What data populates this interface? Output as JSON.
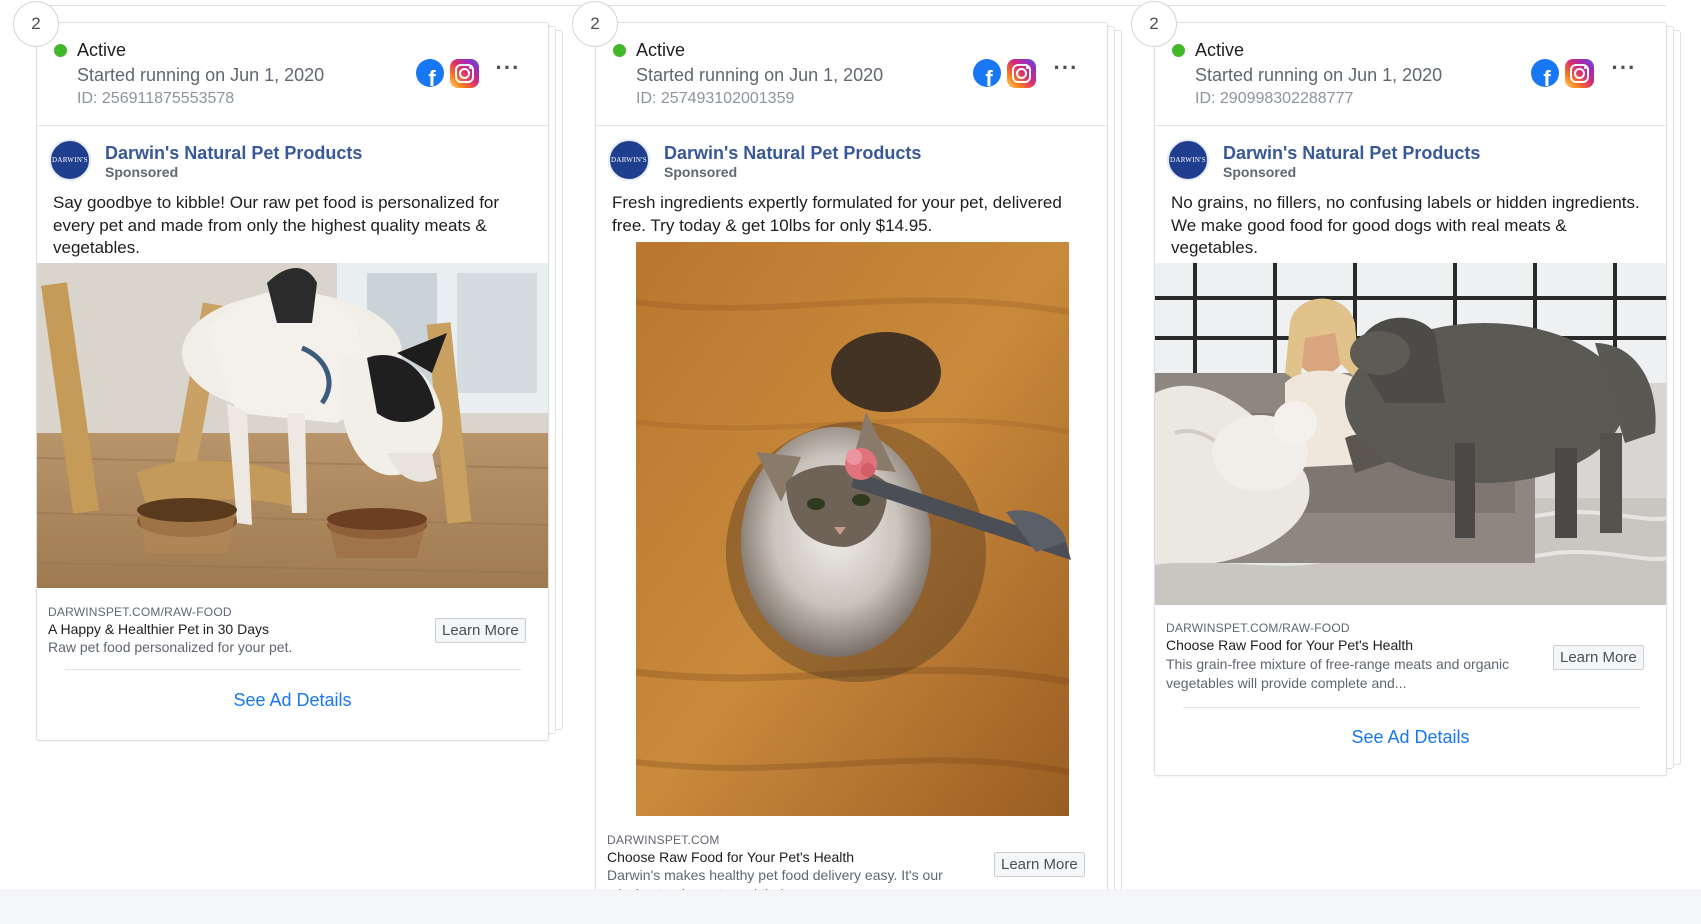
{
  "cards": [
    {
      "count": "2",
      "status": "Active",
      "started": "Started running on Jun 1, 2020",
      "ad_id": "ID: 256911875553578",
      "advertiser": "Darwin's Natural Pet Products",
      "sponsored": "Sponsored",
      "logo_text": "DARWIN'S",
      "body": "Say goodbye to kibble! Our raw pet food is personalized for every pet and made from only the highest quality meats & vegetables.",
      "domain": "DARWINSPET.COM/RAW-FOOD",
      "headline": "A Happy & Healthier Pet in 30 Days",
      "description": "Raw pet food personalized for your pet.",
      "cta": "Learn More",
      "details": "See Ad Details"
    },
    {
      "count": "2",
      "status": "Active",
      "started": "Started running on Jun 1, 2020",
      "ad_id": "ID: 257493102001359",
      "advertiser": "Darwin's Natural Pet Products",
      "sponsored": "Sponsored",
      "logo_text": "DARWIN'S",
      "body": "Fresh ingredients expertly formulated for your pet, delivered free. Try today & get 10lbs for only $14.95.",
      "domain": "DARWINSPET.COM",
      "headline": "Choose Raw Food for Your Pet's Health",
      "description": "Darwin's makes healthy pet food delivery easy. It's our mission to give pets and their owners more...",
      "cta": "Learn More"
    },
    {
      "count": "2",
      "status": "Active",
      "started": "Started running on Jun 1, 2020",
      "ad_id": "ID: 290998302288777",
      "advertiser": "Darwin's Natural Pet Products",
      "sponsored": "Sponsored",
      "logo_text": "DARWIN'S",
      "body": "No grains, no fillers, no confusing labels or hidden ingredients. We make good food for good dogs with real meats & vegetables.",
      "domain": "DARWINSPET.COM/RAW-FOOD",
      "headline": "Choose Raw Food for Your Pet's Health",
      "description": "This grain-free mixture of free-range meats and organic vegetables will provide complete and...",
      "cta": "Learn More",
      "details": "See Ad Details"
    }
  ],
  "icons": {
    "platform_1": "facebook-icon",
    "platform_2": "instagram-icon",
    "menu": "more-options-icon"
  },
  "colors": {
    "active_dot": "#42b72a",
    "advertiser_link": "#385898",
    "details_link": "#1877f2",
    "facebook_blue": "#1877f2"
  }
}
